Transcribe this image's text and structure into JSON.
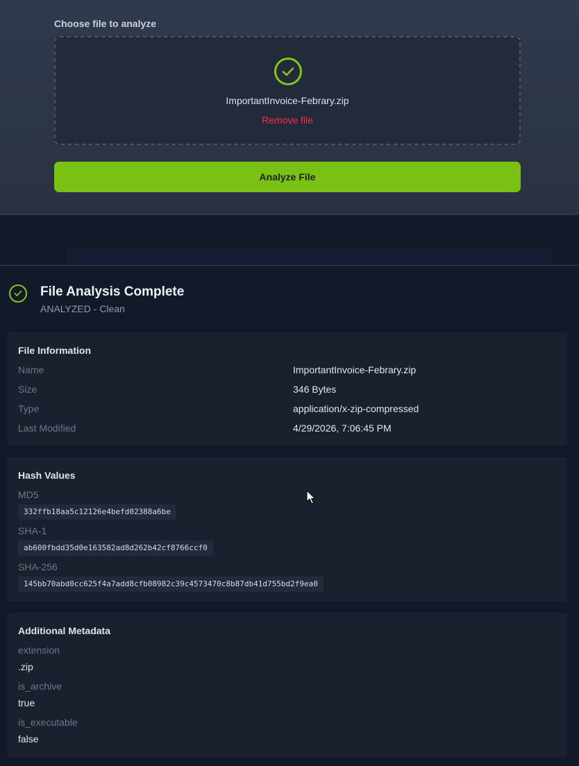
{
  "upload": {
    "label": "Choose file to analyze",
    "file_name": "ImportantInvoice-Febrary.zip",
    "remove_label": "Remove file",
    "analyze_label": "Analyze File"
  },
  "result": {
    "title": "File Analysis Complete",
    "status": "ANALYZED - Clean"
  },
  "file_info": {
    "title": "File Information",
    "rows": [
      {
        "label": "Name",
        "value": "ImportantInvoice-Febrary.zip"
      },
      {
        "label": "Size",
        "value": "346 Bytes"
      },
      {
        "label": "Type",
        "value": "application/x-zip-compressed"
      },
      {
        "label": "Last Modified",
        "value": "4/29/2026, 7:06:45 PM"
      }
    ]
  },
  "hashes": {
    "title": "Hash Values",
    "items": [
      {
        "label": "MD5",
        "value": "332ffb18aa5c12126e4befd02388a6be"
      },
      {
        "label": "SHA-1",
        "value": "ab600fbdd35d0e163582ad8d262b42cf8766ccf0"
      },
      {
        "label": "SHA-256",
        "value": "145bb70abd0cc625f4a7add8cfb08982c39c4573470c8b87db41d755bd2f9ea0"
      }
    ]
  },
  "metadata": {
    "title": "Additional Metadata",
    "items": [
      {
        "key": "extension",
        "value": ".zip"
      },
      {
        "key": "is_archive",
        "value": "true"
      },
      {
        "key": "is_executable",
        "value": "false"
      }
    ]
  },
  "colors": {
    "accent": "#7ac116",
    "danger": "#f0314e",
    "background": "#121a29"
  },
  "icons": {
    "upload_status": "check-circle-icon",
    "result_status": "check-circle-icon",
    "pointer": "mouse-cursor-icon"
  }
}
